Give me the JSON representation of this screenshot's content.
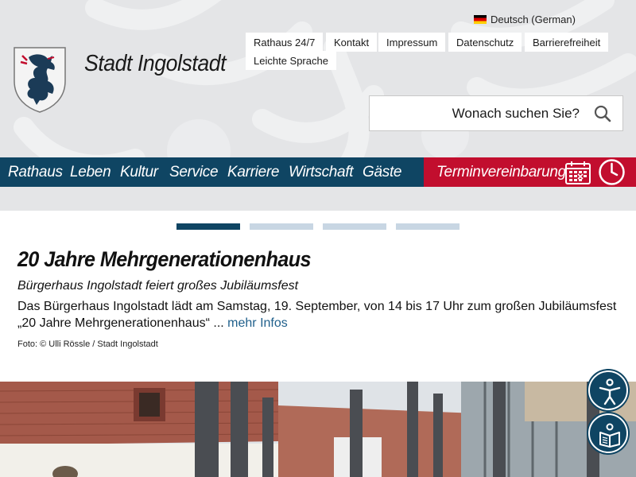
{
  "language": {
    "label": "Deutsch (German)",
    "flag": "german-flag"
  },
  "top_links": [
    "Rathaus 24/7",
    "Kontakt",
    "Impressum",
    "Datenschutz",
    "Barrierefreiheit",
    "Leichte Sprache"
  ],
  "site": {
    "title": "Stadt Ingolstadt"
  },
  "search": {
    "placeholder": "Wonach suchen Sie?"
  },
  "nav": {
    "items": [
      "Rathaus",
      "Leben",
      "Kultur",
      "Service",
      "Karriere",
      "Wirtschaft",
      "Gäste"
    ],
    "appointment": "Terminvereinbarung"
  },
  "slider": {
    "count": 4,
    "active": 1
  },
  "article": {
    "title": "20 Jahre Mehrgenerationenhaus",
    "subtitle": "Bürgerhaus Ingolstadt feiert großes Jubiläumsfest",
    "text": "Das Bürgerhaus Ingolstadt lädt am Samstag, 19. September, von 14 bis 17 Uhr zum großen Jubiläumsfest „20 Jahre Mehrgenerationenhaus“ ...",
    "more": "mehr Infos",
    "caption": "Foto: © Ulli Rössle / Stadt Ingolstadt"
  },
  "colors": {
    "nav": "#0f4563",
    "accent": "#c20e2e",
    "header_bg": "#e4e5e7"
  }
}
